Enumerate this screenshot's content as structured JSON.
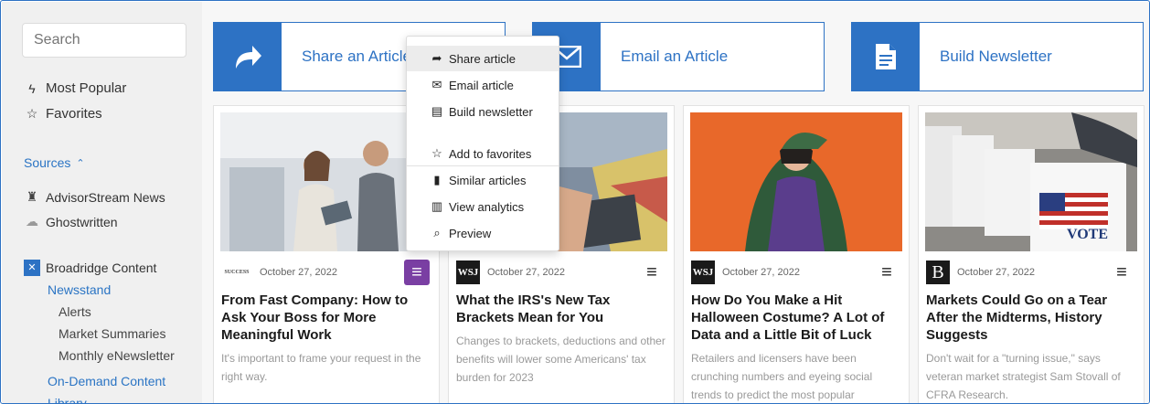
{
  "sidebar": {
    "search_placeholder": "Search",
    "most_popular": "Most Popular",
    "favorites": "Favorites",
    "sources_label": "Sources",
    "sources": [
      {
        "label": "AdvisorStream News",
        "icon": "advisorstream-icon"
      },
      {
        "label": "Ghostwritten",
        "icon": "ghostwritten-icon"
      }
    ],
    "broadridge": "Broadridge Content",
    "newsstand": "Newsstand",
    "newsstand_items": [
      "Alerts",
      "Market Summaries",
      "Monthly eNewsletter"
    ],
    "on_demand": "On-Demand Content",
    "library": "Library"
  },
  "actions": [
    {
      "label": "Share an Article",
      "icon": "share-arrow-icon"
    },
    {
      "label": "Email an Article",
      "icon": "envelope-icon"
    },
    {
      "label": "Build Newsletter",
      "icon": "document-icon"
    }
  ],
  "dropdown": {
    "items": [
      {
        "label": "Share article",
        "icon": "share-icon",
        "glyph": "➦"
      },
      {
        "label": "Email article",
        "icon": "envelope-icon",
        "glyph": "✉"
      },
      {
        "label": "Build newsletter",
        "icon": "document-icon",
        "glyph": "▤"
      },
      {
        "label": "Add to favorites",
        "icon": "star-icon",
        "glyph": "☆"
      },
      {
        "label": "Similar articles",
        "icon": "bookmark-icon",
        "glyph": "▮"
      },
      {
        "label": "View analytics",
        "icon": "bar-chart-icon",
        "glyph": "▥"
      },
      {
        "label": "Preview",
        "icon": "search-icon",
        "glyph": "⌕"
      }
    ]
  },
  "articles": [
    {
      "source": "SUCCESS",
      "date": "October 27, 2022",
      "title": "From Fast Company: How to Ask Your Boss for More Meaningful Work",
      "desc": "It's important to frame your request in the right way."
    },
    {
      "source": "WSJ",
      "date": "October 27, 2022",
      "title": "What the IRS's New Tax Brackets Mean for You",
      "desc": "Changes to brackets, deductions and other benefits will lower some Americans' tax burden for 2023"
    },
    {
      "source": "WSJ",
      "date": "October 27, 2022",
      "title": "How Do You Make a Hit Halloween Costume? A Lot of Data and a Little Bit of Luck",
      "desc": "Retailers and licensers have been crunching numbers and eyeing social trends to predict the most popular"
    },
    {
      "source": "B",
      "date": "October 27, 2022",
      "title": "Markets Could Go on a Tear After the Midterms, History Suggests",
      "desc": "Don't wait for a \"turning issue,\" says veteran market strategist Sam Stovall of CFRA Research."
    }
  ],
  "vote_sign": "VOTE",
  "colors": {
    "accent": "#2d72c4",
    "menu_active": "#7a3fa3"
  }
}
